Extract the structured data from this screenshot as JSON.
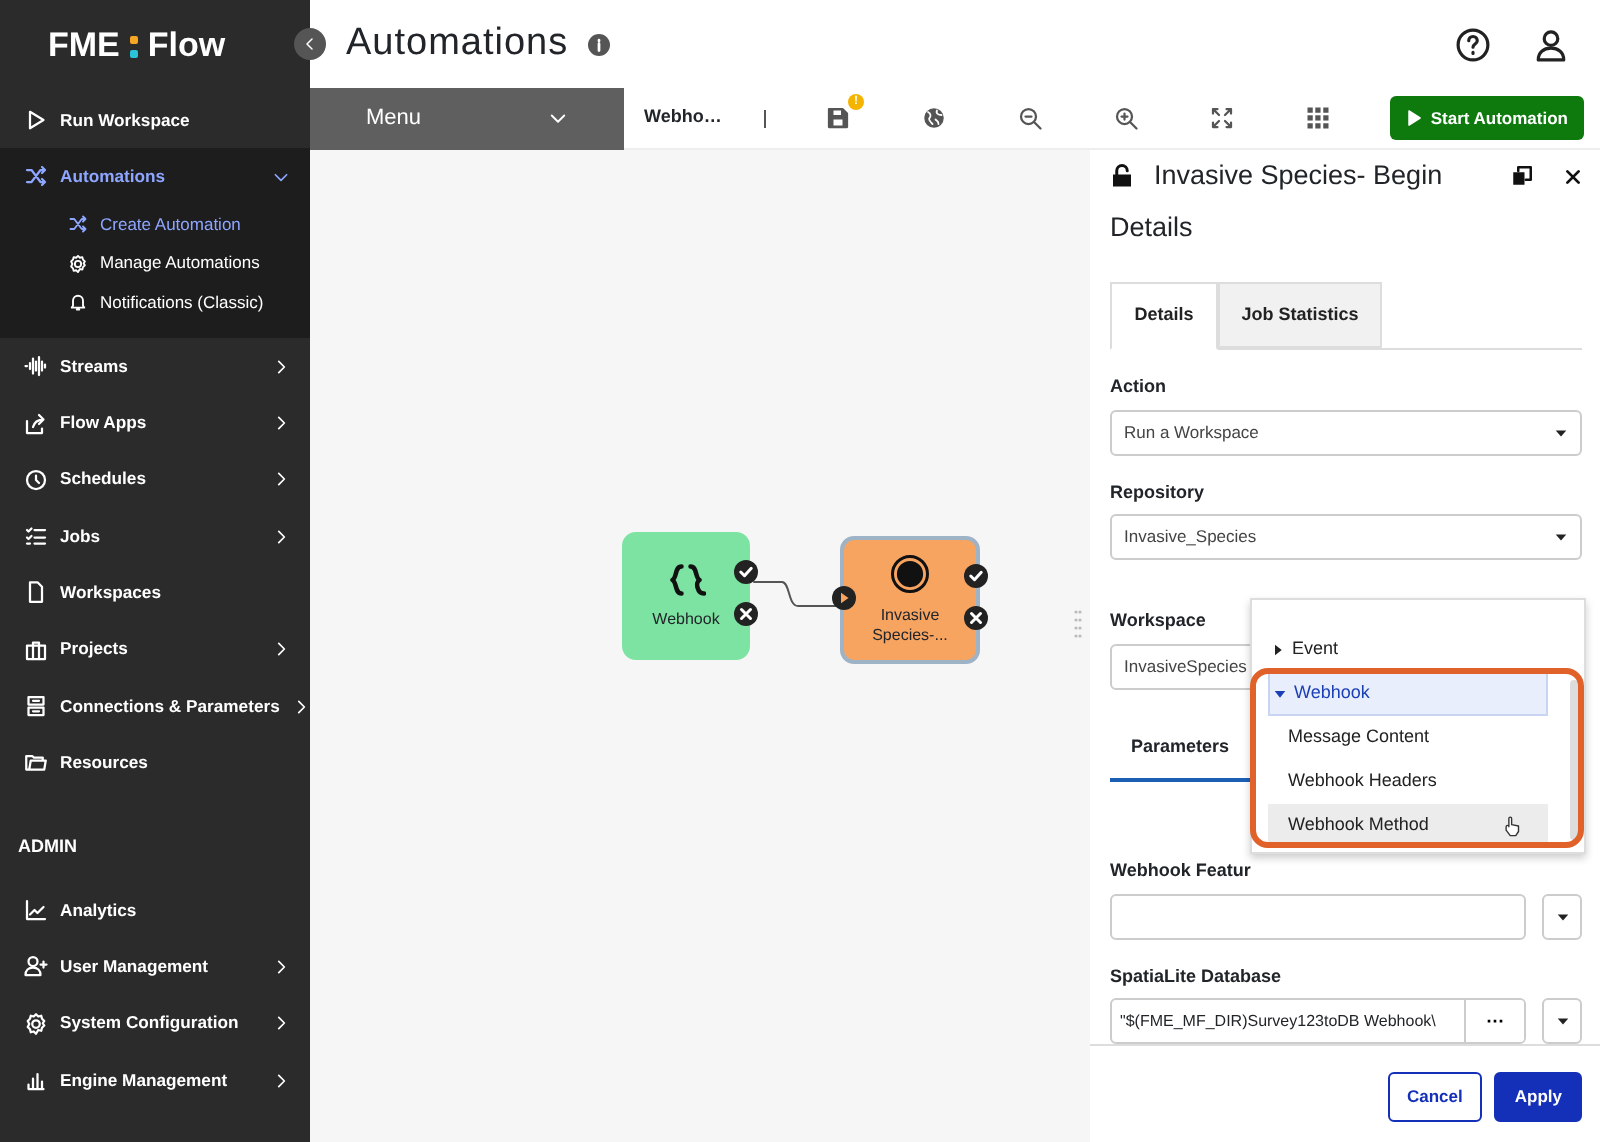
{
  "brand": {
    "name": "FME",
    "suffix": "Flow"
  },
  "sidebar": {
    "items": [
      {
        "label": "Run Workspace",
        "has_children": false,
        "expanded": false,
        "selected": false
      },
      {
        "label": "Automations",
        "has_children": true,
        "expanded": true,
        "selected": true,
        "children": [
          {
            "label": "Create Automation",
            "selected": true
          },
          {
            "label": "Manage Automations",
            "selected": false
          },
          {
            "label": "Notifications (Classic)",
            "selected": false
          }
        ]
      },
      {
        "label": "Streams",
        "has_children": true,
        "expanded": false,
        "selected": false
      },
      {
        "label": "Flow Apps",
        "has_children": true,
        "expanded": false,
        "selected": false
      },
      {
        "label": "Schedules",
        "has_children": true,
        "expanded": false,
        "selected": false
      },
      {
        "label": "Jobs",
        "has_children": true,
        "expanded": false,
        "selected": false
      },
      {
        "label": "Workspaces",
        "has_children": false,
        "expanded": false,
        "selected": false
      },
      {
        "label": "Projects",
        "has_children": true,
        "expanded": false,
        "selected": false
      },
      {
        "label": "Connections & Parameters",
        "has_children": true,
        "expanded": false,
        "selected": false
      },
      {
        "label": "Resources",
        "has_children": false,
        "expanded": false,
        "selected": false
      }
    ],
    "admin_heading": "ADMIN",
    "admin_items": [
      {
        "label": "Analytics",
        "has_children": false
      },
      {
        "label": "User Management",
        "has_children": true
      },
      {
        "label": "System Configuration",
        "has_children": true
      },
      {
        "label": "Engine Management",
        "has_children": true
      }
    ]
  },
  "page": {
    "title": "Automations"
  },
  "toolbar": {
    "menu": "Menu",
    "automation_name": "Webho…",
    "save_badge": "!",
    "start_button": "Start Automation"
  },
  "nodes": [
    {
      "label": "Webhook",
      "kind": "trigger"
    },
    {
      "label": "Invasive Species-...",
      "kind": "action"
    }
  ],
  "panel": {
    "title": "Invasive Species- Begin",
    "subtitle": "Details",
    "tabs": [
      {
        "label": "Details",
        "selected": true
      },
      {
        "label": "Job Statistics",
        "selected": false
      }
    ],
    "fields": [
      {
        "label": "Action",
        "value": "Run a Workspace"
      },
      {
        "label": "Repository",
        "value": "Invasive_Species"
      },
      {
        "label": "Workspace",
        "value": "InvasiveSpecies"
      }
    ],
    "sub_tabs": [
      {
        "label": "Parameters",
        "selected": true
      }
    ],
    "parameters": [
      {
        "label": "Webhook Featur"
      },
      {
        "label": "SpatiaLite Database",
        "value": "\"$(FME_MF_DIR)Survey123toDB Webhook\\",
        "button": "⋯"
      }
    ],
    "cancel": "Cancel",
    "apply": "Apply"
  },
  "popover": {
    "items": [
      {
        "label": "Event",
        "kind": "group",
        "expanded": false,
        "highlighted": false
      },
      {
        "label": "Webhook",
        "kind": "group",
        "expanded": true,
        "highlighted": true
      },
      {
        "label": "Message Content",
        "kind": "option",
        "highlighted": false
      },
      {
        "label": "Webhook Headers",
        "kind": "option",
        "highlighted": false
      },
      {
        "label": "Webhook Method",
        "kind": "option",
        "highlighted": true
      }
    ]
  }
}
